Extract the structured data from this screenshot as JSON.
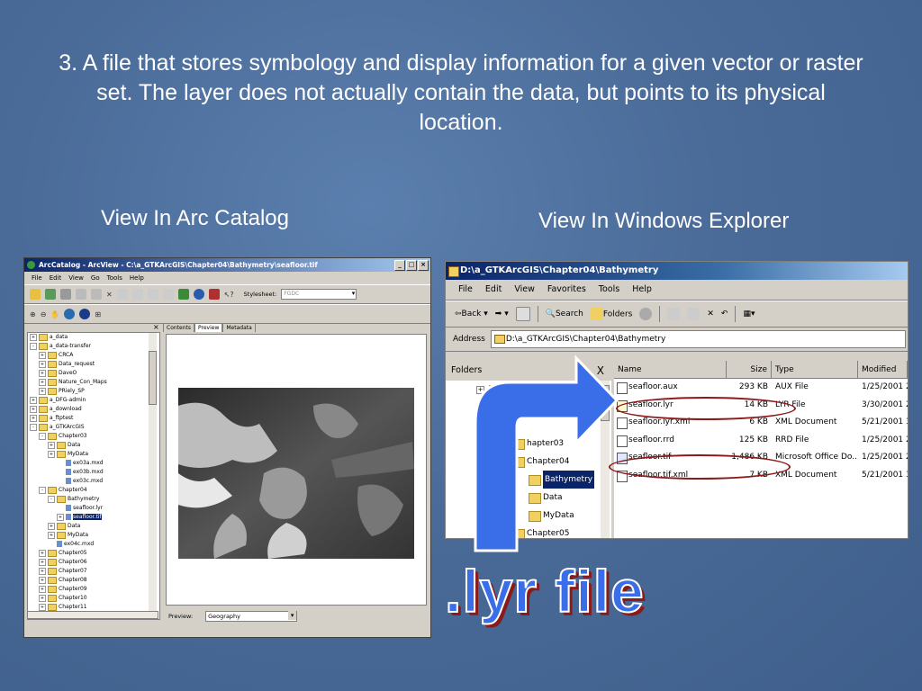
{
  "slide": {
    "title": "3. A file that stores symbology and display information for a given vector or raster set. The layer does not actually contain the data, but points to its physical location.",
    "caption_left": "View In Arc Catalog",
    "caption_right": "View In Windows Explorer",
    "big_label": ".lyr file",
    "colors": {
      "background": "#4a6b98",
      "arrow": "#3a6ee8",
      "highlight_ring": "#8b1a1a"
    }
  },
  "arccatalog": {
    "title": "ArcCatalog - ArcView - C:\\a_GTKArcGIS\\Chapter04\\Bathymetry\\seafloor.tif",
    "menu": [
      "File",
      "Edit",
      "View",
      "Go",
      "Tools",
      "Help"
    ],
    "stylesheet_label": "Stylesheet:",
    "stylesheet_value": "FGDC",
    "tabs": [
      "Contents",
      "Preview",
      "Metadata"
    ],
    "active_tab": "Preview",
    "preview_label": "Preview:",
    "preview_value": "Geography",
    "tree": [
      {
        "label": "a_data",
        "indent": 0,
        "pm": "+"
      },
      {
        "label": "a_data-transfer",
        "indent": 0,
        "pm": "-"
      },
      {
        "label": "CRCA",
        "indent": 1,
        "pm": "+"
      },
      {
        "label": "Data_request",
        "indent": 1,
        "pm": "+"
      },
      {
        "label": "DaveO",
        "indent": 1,
        "pm": "+"
      },
      {
        "label": "Nature_Con_Maps",
        "indent": 1,
        "pm": "+"
      },
      {
        "label": "PRiely_SP",
        "indent": 1,
        "pm": "+"
      },
      {
        "label": "a_DFG-admin",
        "indent": 0,
        "pm": "+"
      },
      {
        "label": "a_download",
        "indent": 0,
        "pm": "+"
      },
      {
        "label": "a_ftptest",
        "indent": 0,
        "pm": "+"
      },
      {
        "label": "a_GTKArcGIS",
        "indent": 0,
        "pm": "-"
      },
      {
        "label": "Chapter03",
        "indent": 1,
        "pm": "-"
      },
      {
        "label": "Data",
        "indent": 2,
        "pm": "+"
      },
      {
        "label": "MyData",
        "indent": 2,
        "pm": "+"
      },
      {
        "label": "ex03a.mxd",
        "indent": 3,
        "pm": "",
        "file": true
      },
      {
        "label": "ex03b.mxd",
        "indent": 3,
        "pm": "",
        "file": true
      },
      {
        "label": "ex03c.mxd",
        "indent": 3,
        "pm": "",
        "file": true
      },
      {
        "label": "Chapter04",
        "indent": 1,
        "pm": "-"
      },
      {
        "label": "Bathymetry",
        "indent": 2,
        "pm": "-"
      },
      {
        "label": "seafloor.lyr",
        "indent": 3,
        "pm": "",
        "file": true
      },
      {
        "label": "seafloor.tif",
        "indent": 3,
        "pm": "+",
        "file": true,
        "selected": true
      },
      {
        "label": "Data",
        "indent": 2,
        "pm": "+"
      },
      {
        "label": "MyData",
        "indent": 2,
        "pm": "+"
      },
      {
        "label": "ex04c.mxd",
        "indent": 2,
        "pm": "",
        "file": true
      },
      {
        "label": "Chapter05",
        "indent": 1,
        "pm": "+"
      },
      {
        "label": "Chapter06",
        "indent": 1,
        "pm": "+"
      },
      {
        "label": "Chapter07",
        "indent": 1,
        "pm": "+"
      },
      {
        "label": "Chapter08",
        "indent": 1,
        "pm": "+"
      },
      {
        "label": "Chapter09",
        "indent": 1,
        "pm": "+"
      },
      {
        "label": "Chapter10",
        "indent": 1,
        "pm": "+"
      },
      {
        "label": "Chapter11",
        "indent": 1,
        "pm": "+"
      }
    ]
  },
  "explorer": {
    "title": "D:\\a_GTKArcGIS\\Chapter04\\Bathymetry",
    "menu": [
      "File",
      "Edit",
      "View",
      "Favorites",
      "Tools",
      "Help"
    ],
    "toolbar": {
      "back": "Back",
      "search": "Search",
      "folders": "Folders"
    },
    "address_label": "Address",
    "address_value": "D:\\a_GTKArcGIS\\Chapter04\\Bathymetry",
    "folders_header": "Folders",
    "folders_close": "X",
    "folder_tree": [
      {
        "label": "a_",
        "pm": "+"
      },
      {
        "label": "",
        "pm": "+"
      },
      {
        "label": "",
        "pm": "-"
      },
      {
        "label": "hapter03",
        "pm": ""
      },
      {
        "label": "Chapter04",
        "pm": ""
      },
      {
        "label": "Bathymetry",
        "pm": "",
        "selected": true
      },
      {
        "label": "Data",
        "pm": ""
      },
      {
        "label": "MyData",
        "pm": ""
      },
      {
        "label": "Chapter05",
        "pm": ""
      }
    ],
    "columns": [
      "Name",
      "Size",
      "Type",
      "Modified"
    ],
    "files": [
      {
        "name": "seafloor.aux",
        "size": "293 KB",
        "type": "AUX File",
        "modified": "1/25/2001 2"
      },
      {
        "name": "seafloor.lyr",
        "size": "14 KB",
        "type": "LYR File",
        "modified": "3/30/2001 2"
      },
      {
        "name": "seafloor.lyr.xml",
        "size": "6 KB",
        "type": "XML Document",
        "modified": "5/21/2001 3"
      },
      {
        "name": "seafloor.rrd",
        "size": "125 KB",
        "type": "RRD File",
        "modified": "1/25/2001 2"
      },
      {
        "name": "seafloor.tif",
        "size": "1,486 KB",
        "type": "Microsoft Office Do...",
        "modified": "1/25/2001 2"
      },
      {
        "name": "seafloor.tif.xml",
        "size": "7 KB",
        "type": "XML Document",
        "modified": "5/21/2001 3"
      }
    ]
  }
}
